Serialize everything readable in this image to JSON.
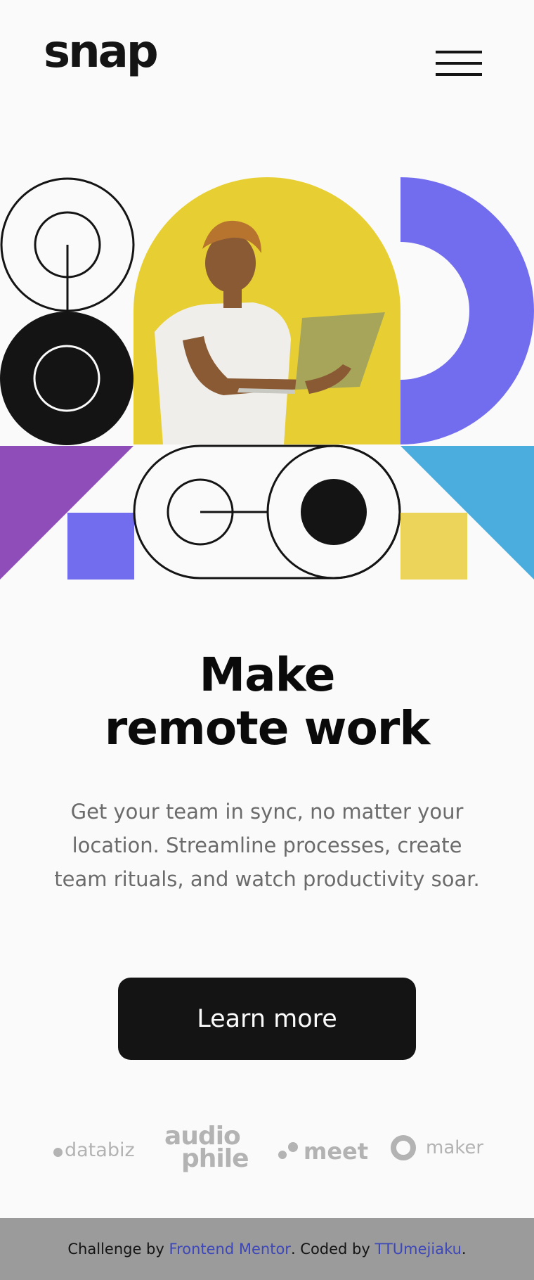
{
  "header": {
    "logo": "snap",
    "menu_icon": "hamburger-menu-icon"
  },
  "hero": {
    "image_description_icon": "hero-illustration",
    "colors": {
      "yellow": "#e7cf33",
      "violet": "#726cee",
      "purple": "#8e4db8",
      "sky_blue": "#4badde",
      "light_yellow": "#ecd45a",
      "dark": "#141414"
    }
  },
  "main": {
    "headline_line1": "Make",
    "headline_line2": "remote work",
    "description": "Get your team in sync, no matter your location. Streamline processes, create team rituals, and watch productivity soar.",
    "cta_label": "Learn more"
  },
  "clients": {
    "databiz": "databiz",
    "audiophile_line1": "audio",
    "audiophile_line2": "phile",
    "meet": "meet",
    "maker": "maker"
  },
  "footer": {
    "prefix": "Challenge by ",
    "link1": "Frontend Mentor",
    "middle": ". Coded by ",
    "link2": "TTUmejiaku",
    "suffix": "."
  }
}
